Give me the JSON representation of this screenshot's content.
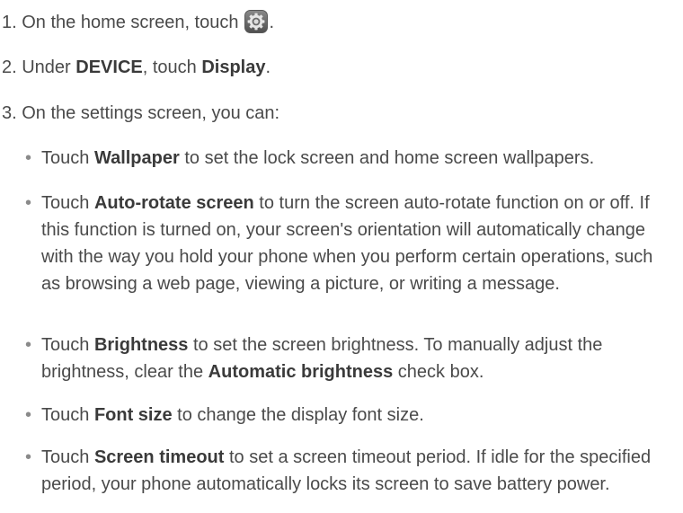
{
  "steps": {
    "s1_before": "1. On the home screen, touch",
    "s1_after": ".",
    "s1_icon": "settings-gear-icon",
    "s2_prefix": "2. Under ",
    "s2_device": "DEVICE",
    "s2_mid": ", touch ",
    "s2_display": "Display",
    "s2_end": ".",
    "s3": "3. On the settings screen, you can:"
  },
  "bullets": [
    {
      "lead": "Touch ",
      "term": "Wallpaper",
      "rest": " to set the lock screen and home screen wallpapers."
    },
    {
      "lead": "Touch ",
      "term": "Auto-rotate screen",
      "rest": " to turn the screen auto-rotate function on or off. If this function is turned on, your screen's orientation will automatically change with the way you hold your phone when you perform certain operations, such as browsing a web page, viewing a picture, or writing a message."
    },
    {
      "lead": "Touch ",
      "term": "Brightness",
      "mid": " to set the screen brightness. To manually adjust the brightness, clear the ",
      "term2": "Automatic brightness",
      "rest": " check box."
    },
    {
      "lead": "Touch ",
      "term": "Font size",
      "rest": " to change the display font size."
    },
    {
      "lead": "Touch ",
      "term": "Screen timeout",
      "rest": " to set a screen timeout period. If idle for the specified period, your phone automatically locks its screen to save battery power."
    }
  ],
  "bullet_glyph": "•"
}
